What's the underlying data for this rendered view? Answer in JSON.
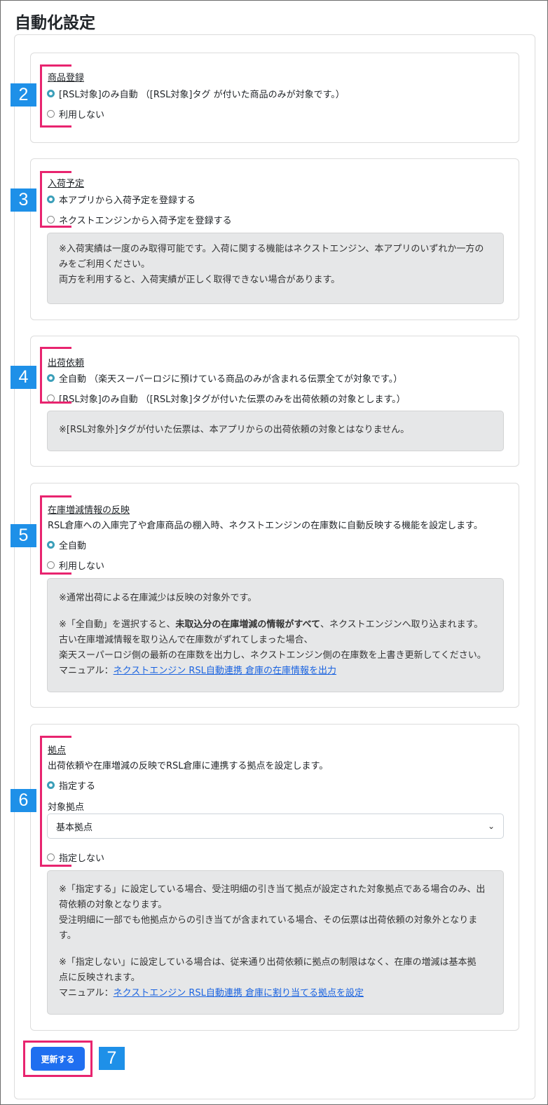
{
  "page_title": "自動化設定",
  "sections": {
    "product": {
      "title": "商品登録",
      "options": [
        "[RSL対象]のみ自動 （[RSL対象]タグ が付いた商品のみが対象です。）",
        "利用しない"
      ],
      "badge": "2"
    },
    "arrival": {
      "title": "入荷予定",
      "options": [
        "本アプリから入荷予定を登録する",
        "ネクストエンジンから入荷予定を登録する"
      ],
      "note": [
        "※入荷実績は一度のみ取得可能です。入荷に関する機能はネクストエンジン、本アプリのいずれか一方の",
        "みをご利用ください。",
        "両方を利用すると、入荷実績が正しく取得できない場合があります。"
      ],
      "badge": "3"
    },
    "shipping": {
      "title": "出荷依頼",
      "options": [
        "全自動 （楽天スーパーロジに預けている商品のみが含まれる伝票全てが対象です。）",
        "[RSL対象]のみ自動 （[RSL対象]タグが付いた伝票のみを出荷依頼の対象とします。）"
      ],
      "note": "※[RSL対象外]タグが付いた伝票は、本アプリからの出荷依頼の対象とはなりません。",
      "badge": "4"
    },
    "inventory": {
      "title": "在庫増減情報の反映",
      "description": "RSL倉庫への入庫完了や倉庫商品の棚入時、ネクストエンジンの在庫数に自動反映する機能を設定します。",
      "options": [
        "全自動",
        "利用しない"
      ],
      "note": {
        "line1": "※通常出荷による在庫減少は反映の対象外です。",
        "line2_pre": "※「全自動」を選択すると、",
        "line2_bold": "未取込分の在庫増減の情報がすべて",
        "line2_post": "、ネクストエンジンへ取り込まれます。",
        "line3": "古い在庫増減情報を取り込んで在庫数がずれてしまった場合、",
        "line4": "楽天スーパーロジ側の最新の在庫数を出力し、ネクストエンジン側の在庫数を上書き更新してください。",
        "manual_label": "マニュアル：",
        "manual_link": "ネクストエンジン RSL自動連携 倉庫の在庫情報を出力"
      },
      "badge": "5"
    },
    "location": {
      "title": "拠点",
      "description": "出荷依頼や在庫増減の反映でRSL倉庫に連携する拠点を設定します。",
      "option_specify": "指定する",
      "field_label": "対象拠点",
      "select_value": "基本拠点",
      "option_none": "指定しない",
      "note": {
        "line1": "※「指定する」に設定している場合、受注明細の引き当て拠点が設定された対象拠点である場合のみ、出",
        "line2": "荷依頼の対象となります。",
        "line3": "受注明細に一部でも他拠点からの引き当てが含まれている場合、その伝票は出荷依頼の対象外となりま",
        "line4": "す。",
        "line5": "※「指定しない」に設定している場合は、従来通り出荷依頼に拠点の制限はなく、在庫の増減は基本拠",
        "line6": "点に反映されます。",
        "manual_label": "マニュアル：",
        "manual_link": "ネクストエンジン RSL自動連携 倉庫に割り当てる拠点を設定"
      },
      "badge": "6"
    }
  },
  "update_button": "更新する",
  "button_badge": "7",
  "colors": {
    "accent": "#1f6ff0",
    "badge": "#1e90e8",
    "highlight": "#e8246f",
    "radio": "#3b9fb9"
  }
}
